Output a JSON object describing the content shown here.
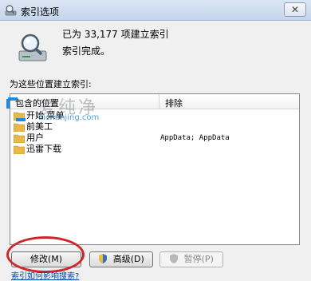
{
  "window": {
    "title": "索引选项",
    "close_glyph": "✕"
  },
  "summary": {
    "line1": "已为 33,177 项建立索引",
    "line2": "索引完成。"
  },
  "locations": {
    "label": "为这些位置建立索引:",
    "columns": {
      "included": "包含的位置",
      "excluded": "排除"
    },
    "rows": [
      {
        "name": "开始 菜单",
        "excluded": ""
      },
      {
        "name": "前美工",
        "excluded": ""
      },
      {
        "name": "用户",
        "excluded": "AppData; AppData"
      },
      {
        "name": "迅雷下载",
        "excluded": ""
      }
    ]
  },
  "watermark": {
    "text": "爱纯净",
    "url": "aichunjing.com"
  },
  "buttons": {
    "modify": "修改(M)",
    "advanced": "高级(D)",
    "pause": "暂停(P)"
  },
  "help_link": "索引如何影响搜索?",
  "icons": {
    "title": "magnifier-drive-icon",
    "big": "magnifier-drive-icon",
    "folder": "folder-icon",
    "shield": "uac-shield-icon"
  },
  "colors": {
    "highlight_ellipse": "#d0262a",
    "folder": "#e8b84a",
    "link": "#0645ad"
  }
}
